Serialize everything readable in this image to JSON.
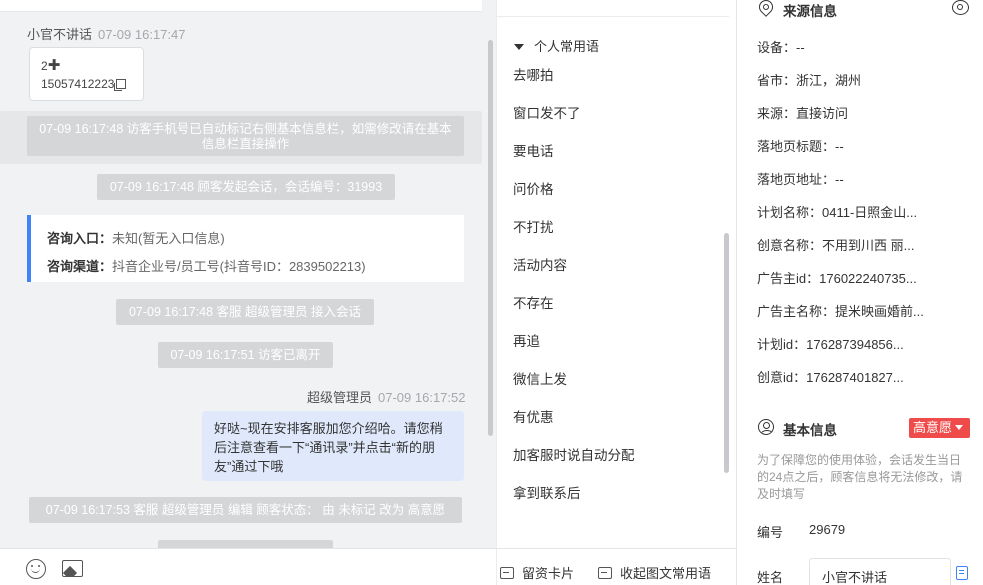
{
  "chat": {
    "visitor_name": "小官不讲话",
    "visitor_time": "07-09 16:17:47",
    "card_line1": "2",
    "card_phone": "15057412223",
    "sys_mark_phone": "07-09 16:17:48 访客手机号已自动标记右侧基本信息栏，如需修改请在基本信息栏直接操作",
    "sys_start": "07-09 16:17:48 顾客发起会话，会话编号：31993",
    "entry_label": "咨询入口：",
    "entry_value": "未知(暂无入口信息)",
    "channel_label": "咨询渠道：",
    "channel_value": "抖音企业号/员工号(抖音号ID：2839502213)",
    "sys_join": "07-09 16:17:48 客服 超级管理员 接入会话",
    "sys_left": "07-09 16:17:51 访客已离开",
    "agent_name": "超级管理员",
    "agent_time": "07-09 16:17:52",
    "agent_message": "好哒~现在安排客服加您介绍哈。请您稍后注意查看一下“通讯录”并点击“新的朋友”通过下哦",
    "sys_edit": "07-09 16:17:53 客服 超级管理员 编辑 顾客状态： 由 未标记 改为 高意愿"
  },
  "phrases": {
    "group_title": "个人常用语",
    "items": [
      "去哪拍",
      "窗口发不了",
      "要电话",
      "问价格",
      "不打扰",
      "活动内容",
      "不存在",
      "再追",
      "微信上发",
      "有优惠",
      "加客服时说自动分配",
      "拿到联系后"
    ],
    "leave_card_label": "留资卡片",
    "collapse_label": "收起图文常用语"
  },
  "source": {
    "title": "来源信息",
    "rows": [
      {
        "label": "设备：",
        "value": "--"
      },
      {
        "label": "省市：",
        "value": "浙江，湖州"
      },
      {
        "label": "来源：",
        "value": "直接访问"
      },
      {
        "label": "落地页标题：",
        "value": "--"
      },
      {
        "label": "落地页地址：",
        "value": "--"
      },
      {
        "label": "计划名称：",
        "value": "0411-日照金山..."
      },
      {
        "label": "创意名称：",
        "value": "不用到川西 丽..."
      },
      {
        "label": "广告主id：",
        "value": "176022240735..."
      },
      {
        "label": "广告主名称：",
        "value": "提米映画婚前..."
      },
      {
        "label": "计划id：",
        "value": "176287394856..."
      },
      {
        "label": "创意id：",
        "value": "176287401827..."
      }
    ]
  },
  "basic": {
    "title": "基本信息",
    "intent_badge": "高意愿",
    "notice": "为了保障您的使用体验，会话发生当日的24点之后，顾客信息将无法修改，请及时填写",
    "id_label": "编号",
    "id_value": "29679",
    "name_label": "姓名",
    "name_value": "小官不讲话"
  },
  "colors": {
    "accent_blue": "#3f83f8",
    "badge_red": "#f04b4b",
    "agent_bubble": "#dfe9fb"
  }
}
